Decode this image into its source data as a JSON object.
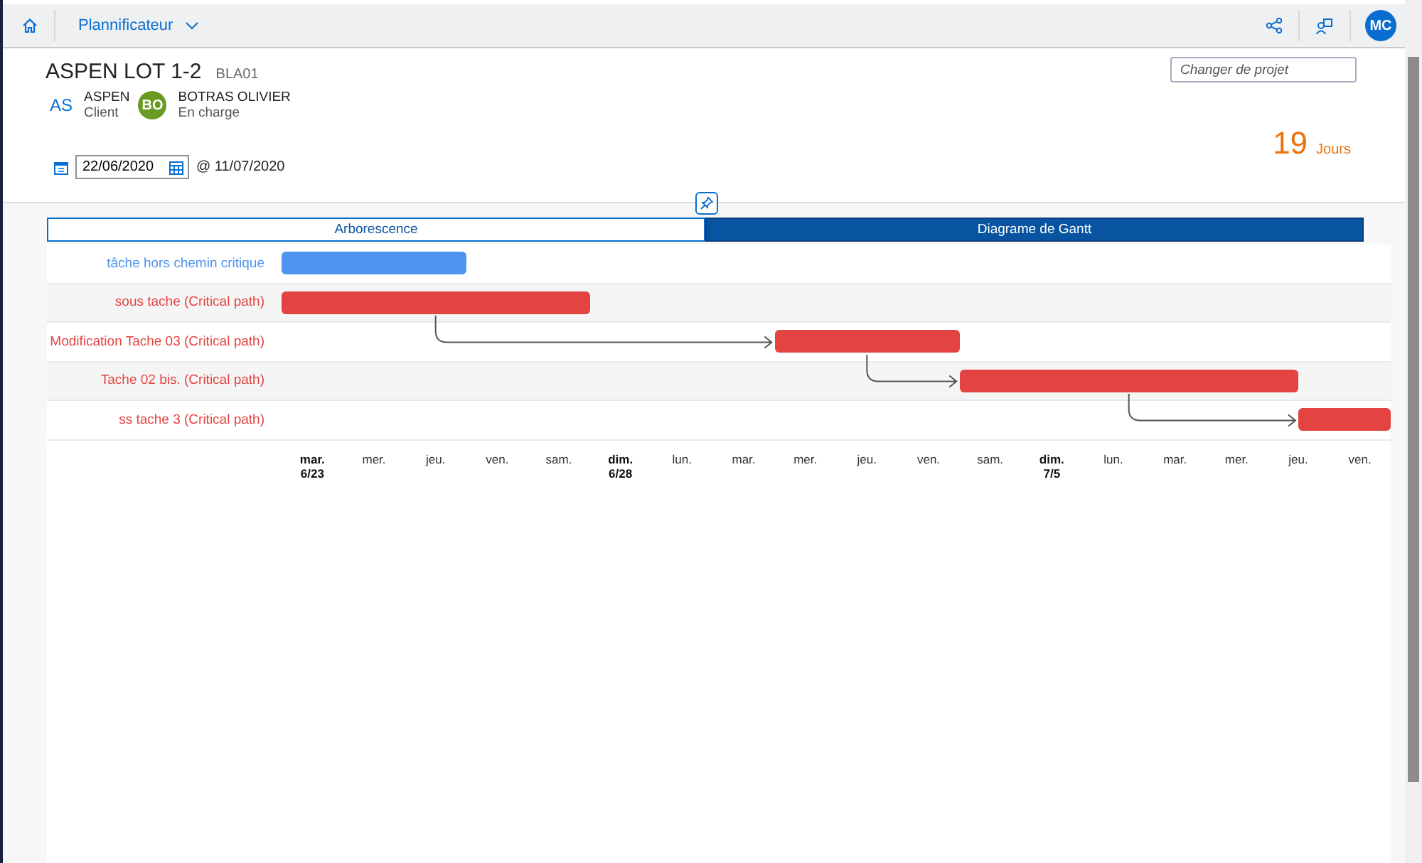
{
  "shell_bar": {
    "app_title": "Plannificateur",
    "user_initials": "MC"
  },
  "project": {
    "title": "ASPEN LOT 1-2",
    "code": "BLA01",
    "switch_placeholder": "Changer de projet",
    "people": [
      {
        "initials": "AS",
        "name": "ASPEN",
        "role": "Client",
        "kind": "text"
      },
      {
        "initials": "BO",
        "name": "BOTRAS OLIVIER",
        "role": "En charge",
        "kind": "avatar"
      }
    ],
    "start_date": "22/06/2020",
    "end_date": "@ 11/07/2020",
    "duration": "19",
    "duration_unit": "Jours"
  },
  "tabs": [
    {
      "label": "Arborescence",
      "selected": false
    },
    {
      "label": "Diagrame de Gantt",
      "selected": true
    }
  ],
  "gantt": {
    "tasks": [
      {
        "name": "tâche hors chemin critique",
        "color": "#4f94ef",
        "linked": false
      },
      {
        "name": "sous tache (Critical path)",
        "color": "#e34441",
        "linked": false
      },
      {
        "name": "Modification Tache 03 (Critical path)",
        "color": "#e34441",
        "linked": true
      },
      {
        "name": "Tache 02 bis. (Critical path)",
        "color": "#e34441",
        "linked": true
      },
      {
        "name": "ss tache 3 (Critical path)",
        "color": "#e34441",
        "linked": true
      }
    ],
    "days": [
      {
        "day": "mar.",
        "date": "6/23"
      },
      {
        "day": "mer."
      },
      {
        "day": "jeu."
      },
      {
        "day": "ven."
      },
      {
        "day": "sam."
      },
      {
        "day": "dim.",
        "date": "6/28"
      },
      {
        "day": "lun."
      },
      {
        "day": "mar."
      },
      {
        "day": "mer."
      },
      {
        "day": "jeu."
      },
      {
        "day": "ven."
      },
      {
        "day": "sam."
      },
      {
        "day": "dim.",
        "date": "7/5"
      },
      {
        "day": "lun."
      },
      {
        "day": "mar."
      },
      {
        "day": "mer."
      },
      {
        "day": "jeu."
      },
      {
        "day": "ven."
      }
    ]
  }
}
